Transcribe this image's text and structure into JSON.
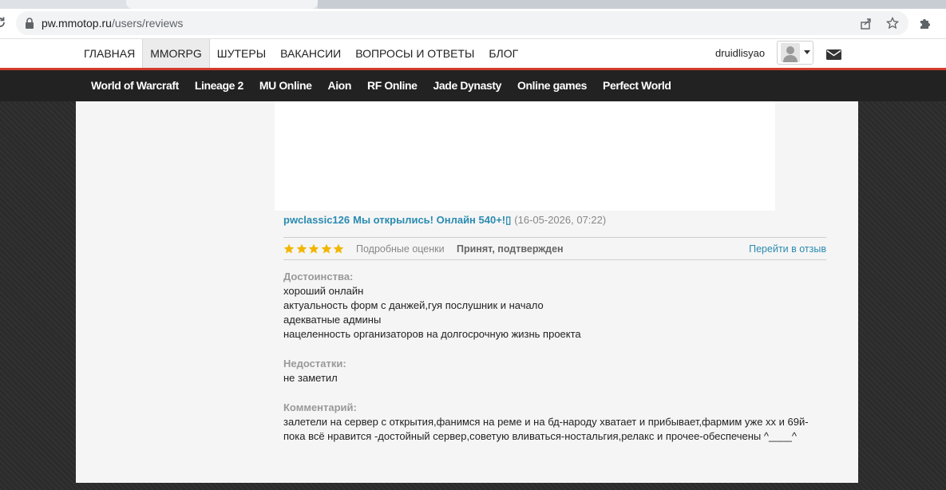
{
  "browser": {
    "url_host": "pw.mmotop.ru",
    "url_path": "/users/reviews"
  },
  "header": {
    "nav": [
      "ГЛАВНАЯ",
      "MMORPG",
      "ШУТЕРЫ",
      "ВАКАНСИИ",
      "ВОПРОСЫ И ОТВЕТЫ",
      "БЛОГ"
    ],
    "active_nav": "MMORPG",
    "username": "druidlisyao",
    "accent_color": "#d23b2a"
  },
  "game_nav": [
    "World of Warcraft",
    "Lineage 2",
    "MU Online",
    "Aion",
    "RF Online",
    "Jade Dynasty",
    "Online games",
    "Perfect World"
  ],
  "review": {
    "author": "pwclassic126",
    "server": "Мы открылись! Онлайн 540+!▯",
    "date": "(16-05-2026, 07:22)",
    "rating_stars": 5,
    "details_label": "Подробные оценки",
    "status": "Принят, подтвержден",
    "goto_label": "Перейти в отзыв",
    "pros_title": "Достоинства:",
    "pros": [
      "хороший онлайн",
      "актуальность форм с данжей,гуя послушник и начало",
      "адекватные админы",
      "нацеленность организаторов на долгосрочную жизнь проекта"
    ],
    "cons_title": "Недостатки:",
    "cons": [
      "не заметил"
    ],
    "comment_title": "Комментарий:",
    "comment": [
      "залетели на сервер с открытия,фанимся на реме и на бд-народу хватает и прибывает,фармим уже хх и 69й-",
      "пока всё нравится -достойный сервер,советую вливаться-ностальгия,релакс и прочее-обеспечены ^____^"
    ]
  }
}
